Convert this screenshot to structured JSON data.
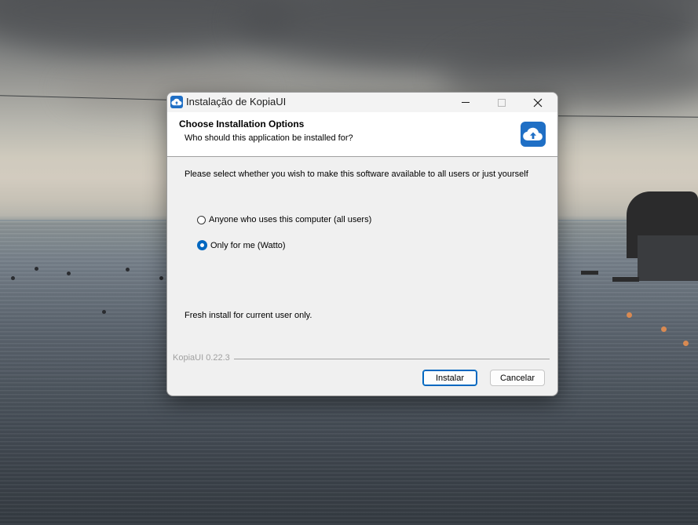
{
  "window": {
    "title": "Instalação de KopiaUI",
    "app_icon": "kopia-cloud-upload-icon"
  },
  "header": {
    "title": "Choose Installation Options",
    "subtitle": "Who should this application be installed for?"
  },
  "body": {
    "description": "Please select whether you wish to make this software available to all users or just yourself",
    "options": [
      {
        "label": "Anyone who uses this computer (all users)",
        "selected": false
      },
      {
        "label": "Only for me (Watto)",
        "selected": true
      }
    ],
    "install_note": "Fresh install for current user only."
  },
  "footer": {
    "version": "KopiaUI 0.22.3",
    "install_label": "Instalar",
    "cancel_label": "Cancelar"
  },
  "colors": {
    "accent": "#0067c0",
    "icon_bg": "#1f6fc5"
  }
}
